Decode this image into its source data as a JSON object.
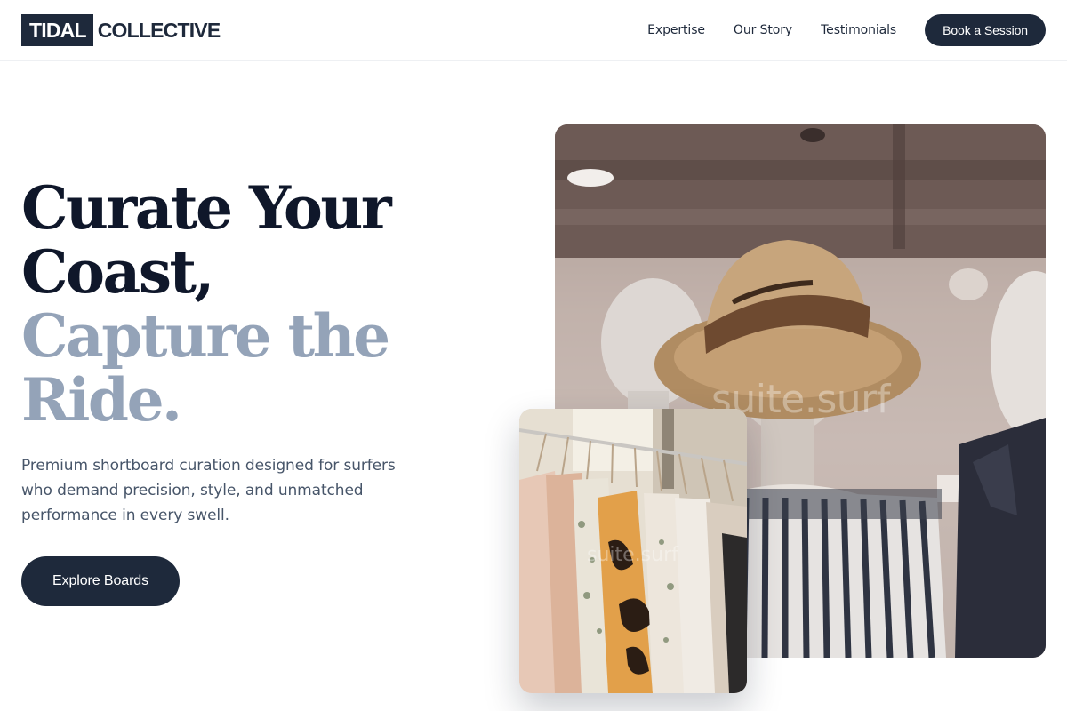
{
  "brand": {
    "logo_box": "TIDAL",
    "logo_text": "COLLECTIVE"
  },
  "nav": {
    "links": [
      "Expertise",
      "Our Story",
      "Testimonials"
    ],
    "cta": "Book a Session"
  },
  "hero": {
    "headline_dark_1": "Curate Your",
    "headline_dark_2": "Coast,",
    "headline_light_1": "Capture the",
    "headline_light_2": "Ride.",
    "subtext": "Premium shortboard curation designed for surfers who demand precision, style, and unmatched performance in every swell.",
    "cta": "Explore Boards"
  },
  "images": {
    "main_watermark": "suite.surf",
    "rack_watermark": "suite.surf"
  },
  "colors": {
    "primary": "#1e293b",
    "headline_dark": "#0f172a",
    "headline_light": "#94a3b8",
    "body_text": "#475569"
  }
}
